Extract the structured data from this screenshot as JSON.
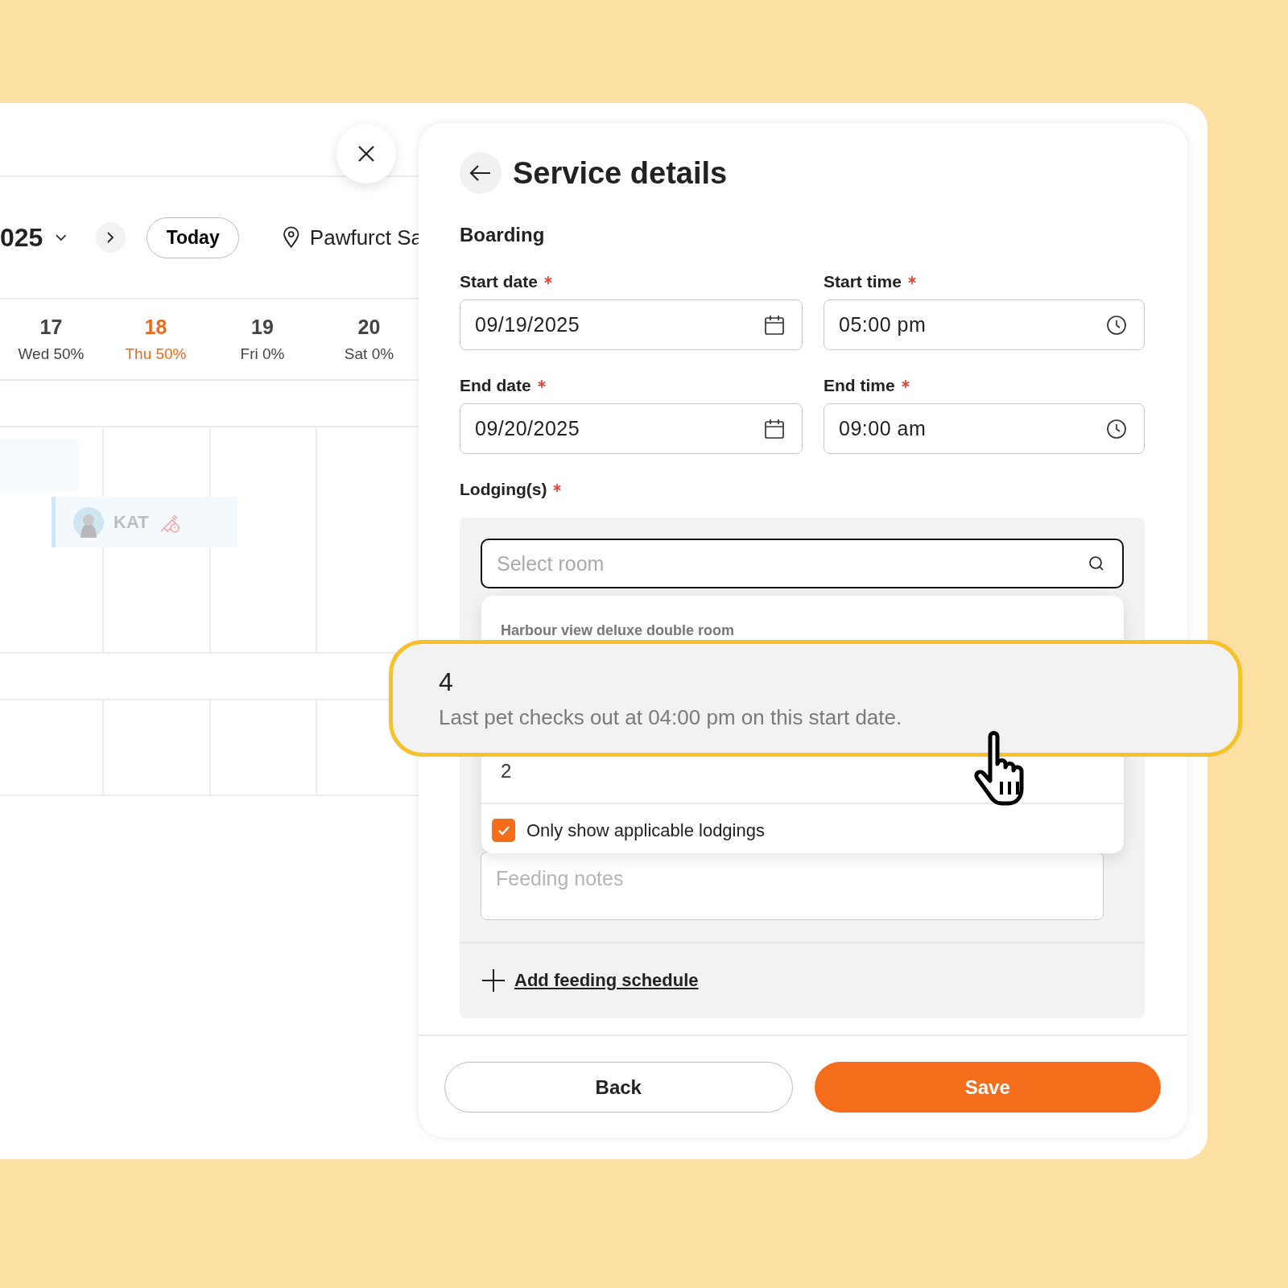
{
  "calendar": {
    "period": "025",
    "today_button": "Today",
    "location": "Pawfurct Sa",
    "days": [
      {
        "number": "17",
        "label": "Wed 50%",
        "today": false
      },
      {
        "number": "18",
        "label": "Thu 50%",
        "today": true
      },
      {
        "number": "19",
        "label": "Fri 0%",
        "today": false
      },
      {
        "number": "20",
        "label": "Sat 0%",
        "today": false
      }
    ],
    "events": [
      {
        "pet": "KAT",
        "vaccine_alert": true
      }
    ]
  },
  "panel": {
    "title": "Service details",
    "service": "Boarding",
    "fields": [
      {
        "label": "Start date",
        "required": true,
        "value": "09/19/2025",
        "kind": "date"
      },
      {
        "label": "Start time",
        "required": true,
        "value": "05:00 pm",
        "kind": "time"
      },
      {
        "label": "End date",
        "required": true,
        "value": "09/20/2025",
        "kind": "date"
      },
      {
        "label": "End time",
        "required": true,
        "value": "09:00 am",
        "kind": "time"
      }
    ],
    "lodging": {
      "label": "Lodging(s)",
      "required": true,
      "placeholder": "Select room",
      "group": "Harbour view deluxe double room",
      "options": [
        "2"
      ],
      "filter": {
        "label": "Only show applicable lodgings",
        "checked": true
      }
    },
    "feeding": {
      "placeholder": "Feeding notes",
      "add_link": "Add feeding schedule"
    },
    "buttons": [
      {
        "label": "Back",
        "kind": "secondary"
      },
      {
        "label": "Save",
        "kind": "primary"
      }
    ]
  },
  "tooltip": {
    "number": "4",
    "message": "Last pet checks out at 04:00 pm on this start date."
  }
}
